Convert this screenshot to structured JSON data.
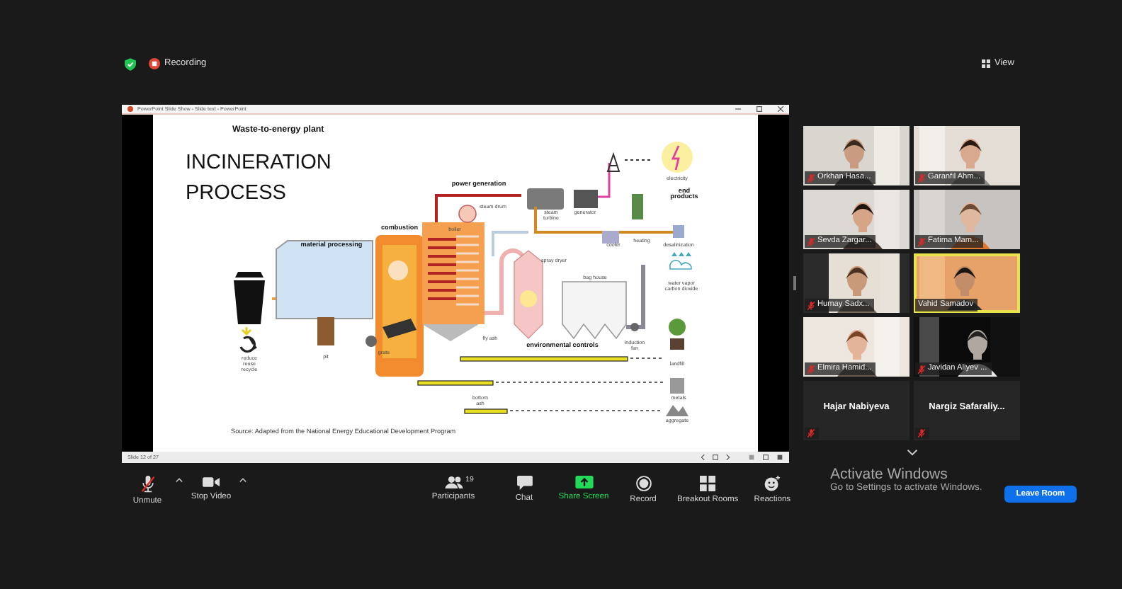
{
  "meeting": {
    "recording_label": "Recording",
    "view_label": "View"
  },
  "shared_window": {
    "title": "PowerPoint Slide Show  -  Slide text  -  PowerPoint",
    "status": "Slide 12 of 27",
    "slide": {
      "heading": "Waste-to-energy plant",
      "title_lines": [
        "INCINERATION",
        "PROCESS"
      ],
      "diagram_labels": [
        {
          "lines": [
            "power generation"
          ],
          "kind": "section"
        },
        {
          "lines": [
            "steam drum"
          ],
          "kind": "note"
        },
        {
          "lines": [
            "electricity"
          ],
          "kind": "note"
        },
        {
          "lines": [
            "end",
            "products"
          ],
          "kind": "section"
        },
        {
          "lines": [
            "boiler"
          ],
          "kind": "note"
        },
        {
          "lines": [
            "steam",
            "turbine"
          ],
          "kind": "note"
        },
        {
          "lines": [
            "generator"
          ],
          "kind": "note"
        },
        {
          "lines": [
            "combustion"
          ],
          "kind": "section"
        },
        {
          "lines": [
            "material processing"
          ],
          "kind": "section"
        },
        {
          "lines": [
            "cooler"
          ],
          "kind": "note"
        },
        {
          "lines": [
            "heating"
          ],
          "kind": "note"
        },
        {
          "lines": [
            "desalinization"
          ],
          "kind": "note"
        },
        {
          "lines": [
            "spray dryer"
          ],
          "kind": "note"
        },
        {
          "lines": [
            "bag house"
          ],
          "kind": "note"
        },
        {
          "lines": [
            "water vapor",
            "carbon dioxide"
          ],
          "kind": "note"
        },
        {
          "lines": [
            "fly ash"
          ],
          "kind": "note"
        },
        {
          "lines": [
            "environmental controls"
          ],
          "kind": "section"
        },
        {
          "lines": [
            "induction",
            "fan"
          ],
          "kind": "note"
        },
        {
          "lines": [
            "grate"
          ],
          "kind": "note"
        },
        {
          "lines": [
            "pit"
          ],
          "kind": "note"
        },
        {
          "lines": [
            "reduce",
            "reuse",
            "recycle"
          ],
          "kind": "note"
        },
        {
          "lines": [
            "landfill"
          ],
          "kind": "note"
        },
        {
          "lines": [
            "metals"
          ],
          "kind": "note"
        },
        {
          "lines": [
            "bottom",
            "ash"
          ],
          "kind": "note"
        },
        {
          "lines": [
            "aggregate"
          ],
          "kind": "note"
        }
      ],
      "source": "Source: Adapted from the National Energy Educational Development Program"
    }
  },
  "participants": [
    {
      "name": "Orkhan Hasa...",
      "video": true,
      "muted": true,
      "speaking": false
    },
    {
      "name": "Garanfil Ahm...",
      "video": true,
      "muted": true,
      "speaking": false
    },
    {
      "name": "Sevda Zargar...",
      "video": true,
      "muted": true,
      "speaking": false
    },
    {
      "name": "Fatima Mam...",
      "video": true,
      "muted": true,
      "speaking": false
    },
    {
      "name": "Humay Sadx...",
      "video": true,
      "muted": true,
      "speaking": false
    },
    {
      "name": "Vahid Samadov",
      "video": true,
      "muted": false,
      "speaking": true
    },
    {
      "name": "Elmira Hamid...",
      "video": true,
      "muted": true,
      "speaking": false
    },
    {
      "name": "Javidan Aliyev ...",
      "video": true,
      "muted": true,
      "speaking": false
    },
    {
      "name": "Hajar Nabiyeva",
      "video": false,
      "muted": true,
      "speaking": false
    },
    {
      "name": "Nargiz Safaraliy...",
      "video": false,
      "muted": true,
      "speaking": false
    }
  ],
  "toolbar": {
    "buttons": [
      {
        "kind": "audio",
        "label": "Unmute",
        "muted": true
      },
      {
        "kind": "video",
        "label": "Stop Video"
      },
      {
        "kind": "participants",
        "label": "Participants",
        "count": "19"
      },
      {
        "kind": "chat",
        "label": "Chat"
      },
      {
        "kind": "share",
        "label": "Share Screen"
      },
      {
        "kind": "record",
        "label": "Record"
      },
      {
        "kind": "breakout",
        "label": "Breakout Rooms"
      },
      {
        "kind": "reactions",
        "label": "Reactions"
      }
    ],
    "leave_label": "Leave Room"
  },
  "os_notice": {
    "title": "Activate Windows",
    "text": "Go to Settings to activate Windows."
  }
}
